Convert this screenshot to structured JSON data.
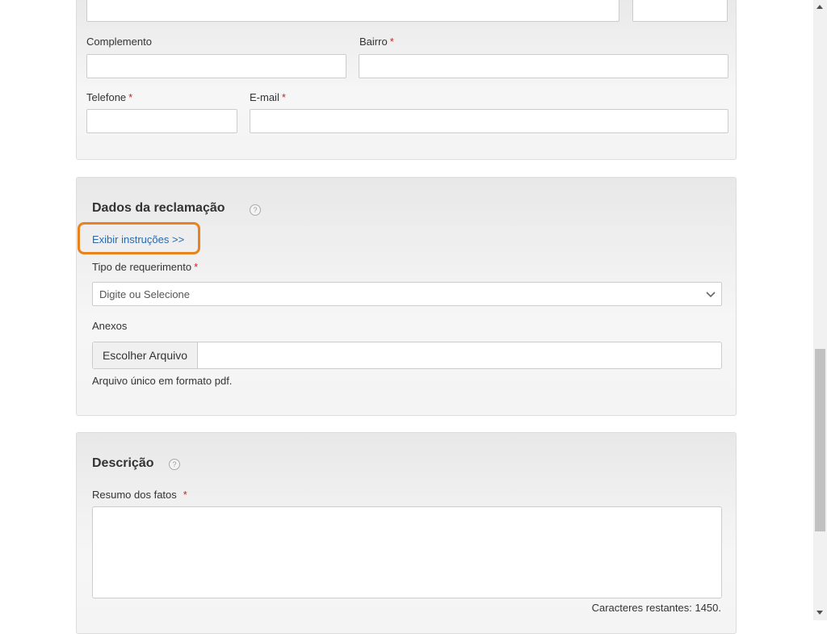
{
  "address_section": {
    "complemento_label": "Complemento",
    "bairro_label": "Bairro",
    "telefone_label": "Telefone",
    "email_label": "E-mail",
    "required_mark": "*"
  },
  "complaint_section": {
    "title": "Dados da reclamação",
    "help": "?",
    "instructions_link": "Exibir instruções >>",
    "tipo_label": "Tipo de requerimento",
    "tipo_placeholder": "Digite ou Selecione",
    "anexos_label": "Anexos",
    "file_button": "Escolher Arquivo",
    "file_hint": "Arquivo único em formato pdf."
  },
  "description_section": {
    "title": "Descrição",
    "help": "?",
    "resumo_label": "Resumo dos fatos",
    "remaining": "Caracteres restantes: 1450."
  },
  "colors": {
    "accent_highlight": "#e8821e",
    "link": "#2a6aad",
    "required": "#cc2222"
  }
}
